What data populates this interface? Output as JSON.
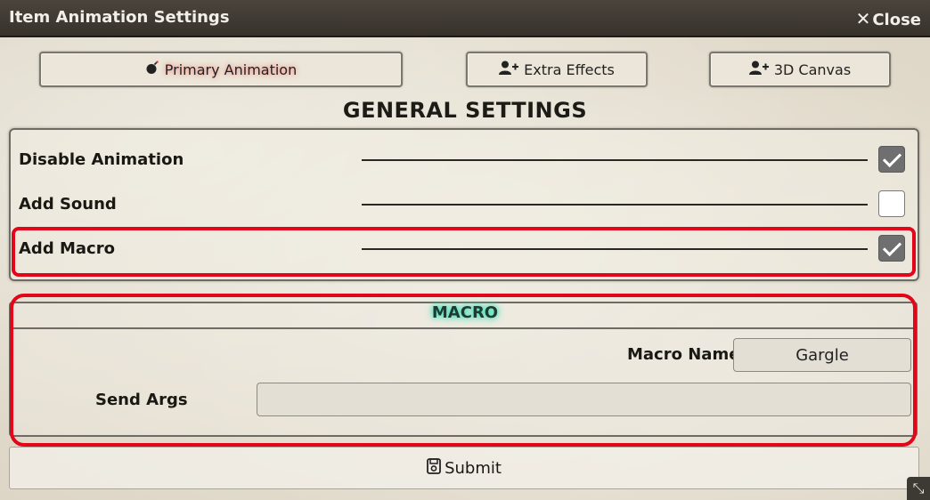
{
  "window": {
    "title": "Item Animation Settings",
    "close_label": "Close"
  },
  "tabs": [
    {
      "label": "Primary Animation",
      "icon": "bomb-icon",
      "active": true
    },
    {
      "label": "Extra Effects",
      "icon": "user-plus-icon",
      "active": false
    },
    {
      "label": "3D Canvas",
      "icon": "user-plus-icon",
      "active": false
    }
  ],
  "general": {
    "title": "GENERAL SETTINGS",
    "rows": [
      {
        "label": "Disable Animation",
        "checked": true
      },
      {
        "label": "Add Sound",
        "checked": false
      },
      {
        "label": "Add Macro",
        "checked": true
      }
    ]
  },
  "macro": {
    "title": "MACRO",
    "name_label": "Macro Name",
    "name_value": "Gargle",
    "args_label": "Send Args",
    "args_value": ""
  },
  "submit_label": "Submit",
  "colors": {
    "highlight": "#e3061a",
    "titlebar": "#3f3a33",
    "macro_glow": "#35e0b4"
  }
}
